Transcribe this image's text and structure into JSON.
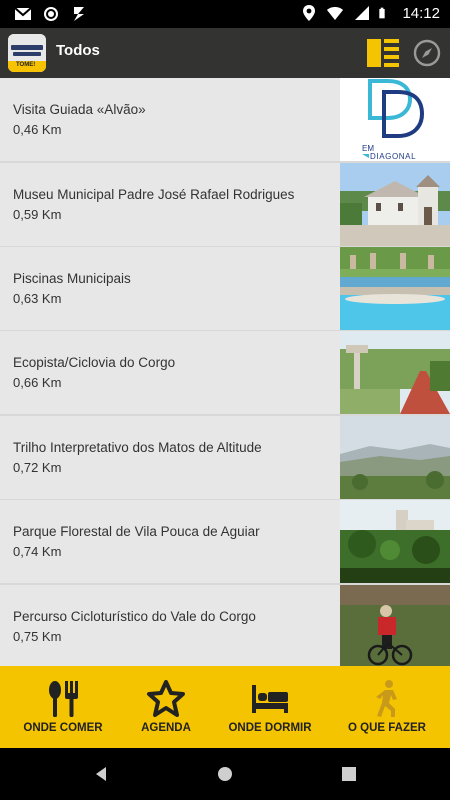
{
  "status_bar": {
    "time": "14:12",
    "left_icons": [
      "gmail-icon",
      "circle-icon",
      "download-icon"
    ],
    "right_icons": [
      "location-icon",
      "wifi-icon",
      "signal-icon",
      "battery-icon"
    ]
  },
  "app_bar": {
    "title": "Todos",
    "logo_text": "TOME!",
    "logo_alt": "Vila Pouca de Aguiar"
  },
  "colors": {
    "accent": "#f5c400",
    "appbar": "#333332",
    "row_bg": "#e7e7e7",
    "divider": "#d8d8d8"
  },
  "items": [
    {
      "name": "Visita Guiada «Alvão»",
      "distance": "0,46 Km",
      "thumb": "em-diagonal-logo",
      "logo_text_top": "EM",
      "logo_text_bottom": "DIAGONAL"
    },
    {
      "name": "Museu Municipal Padre José Rafael Rodrigues",
      "distance": "0,59 Km",
      "thumb": "museum-photo"
    },
    {
      "name": "Piscinas Municipais",
      "distance": "0,63 Km",
      "thumb": "pool-photo"
    },
    {
      "name": "Ecopista/Ciclovia do Corgo",
      "distance": "0,66 Km",
      "thumb": "cycleway-photo"
    },
    {
      "name": "Trilho Interpretativo dos Matos de Altitude",
      "distance": "0,72 Km",
      "thumb": "mountain-photo"
    },
    {
      "name": "Parque Florestal de Vila Pouca de Aguiar",
      "distance": "0,74 Km",
      "thumb": "park-photo"
    },
    {
      "name": "Percurso Cicloturístico do Vale do Corgo",
      "distance": "0,75 Km",
      "thumb": "cyclist-photo"
    }
  ],
  "bottom_nav": [
    {
      "label": "ONDE COMER",
      "icon": "fork-spoon-icon"
    },
    {
      "label": "AGENDA",
      "icon": "star-icon"
    },
    {
      "label": "ONDE DORMIR",
      "icon": "bed-icon"
    },
    {
      "label": "O QUE FAZER",
      "icon": "running-person-icon"
    }
  ]
}
